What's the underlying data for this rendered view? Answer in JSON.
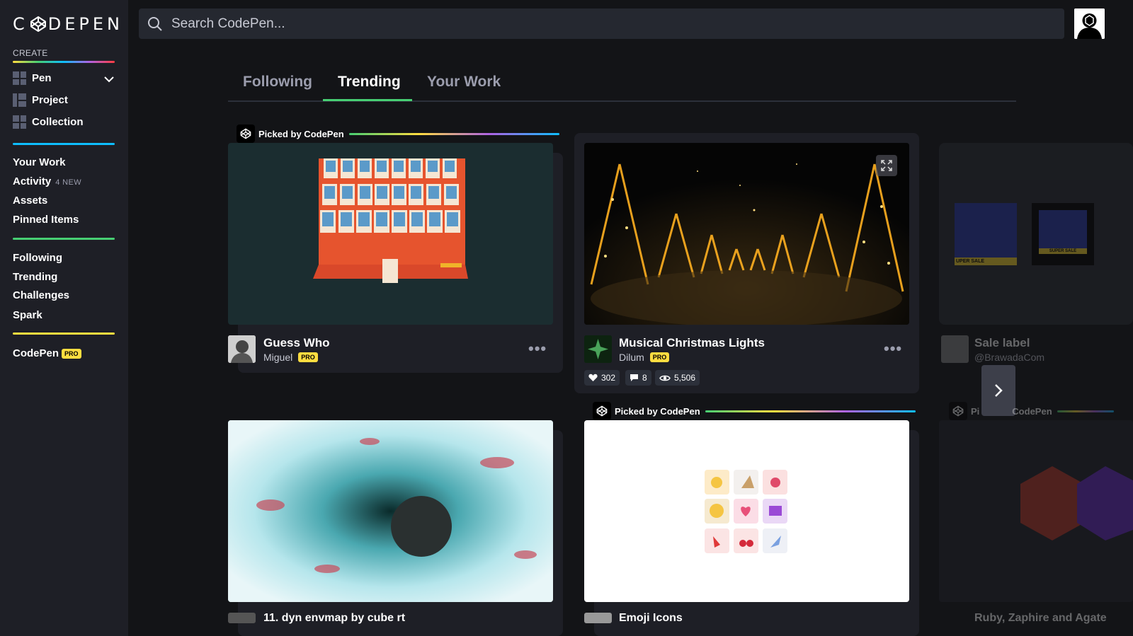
{
  "app": {
    "title": "CodePen",
    "logo_text": "CODEPEN"
  },
  "sidebar": {
    "create_label": "CREATE",
    "create_items": [
      {
        "label": "Pen",
        "icon": "pen-grid-icon"
      },
      {
        "label": "Project",
        "icon": "project-grid-icon"
      },
      {
        "label": "Collection",
        "icon": "collection-grid-icon"
      }
    ],
    "nav_group1": [
      {
        "label": "Your Work"
      },
      {
        "label": "Activity",
        "badge": "4 NEW"
      },
      {
        "label": "Assets"
      },
      {
        "label": "Pinned Items"
      }
    ],
    "nav_group2": [
      {
        "label": "Following"
      },
      {
        "label": "Trending"
      },
      {
        "label": "Challenges"
      },
      {
        "label": "Spark"
      }
    ],
    "codepen_pro_label": "CodePen",
    "pro_badge": "PRO",
    "colors": {
      "create_sep": "gradient",
      "sep1": "#0ebeff",
      "sep2": "#47cf73",
      "sep3": "#ffdd40"
    }
  },
  "search": {
    "placeholder": "Search CodePen..."
  },
  "tabs": [
    {
      "label": "Following",
      "active": false
    },
    {
      "label": "Trending",
      "active": true
    },
    {
      "label": "Your Work",
      "active": false
    }
  ],
  "picked_label": "Picked by CodePen",
  "cards": [
    {
      "title": "Guess Who",
      "user": "Miguel",
      "pro": "PRO",
      "picked": true
    },
    {
      "title": "Musical Christmas Lights",
      "user": "Dilum",
      "pro": "PRO",
      "picked": false,
      "stats": {
        "likes": "302",
        "comments": "8",
        "views": "5,506"
      }
    },
    {
      "title": "Sale label",
      "user": "@BrawadaCom",
      "picked": false
    },
    {
      "title": "11. dyn envmap by cube rt",
      "picked": false
    },
    {
      "title": "Emoji Icons",
      "picked": true
    },
    {
      "title": "Ruby, Zaphire and Agate",
      "picked": true
    }
  ],
  "picked_partial": "Pi",
  "picked_partial_tail": "CodePen",
  "sale_preview_labels": [
    "UPER SALE",
    "SUPER SALE"
  ],
  "colors": {
    "accent_green": "#47cf73",
    "pro_yellow": "#ffdd40",
    "bg": "#131417",
    "panel": "#1e1f26"
  }
}
